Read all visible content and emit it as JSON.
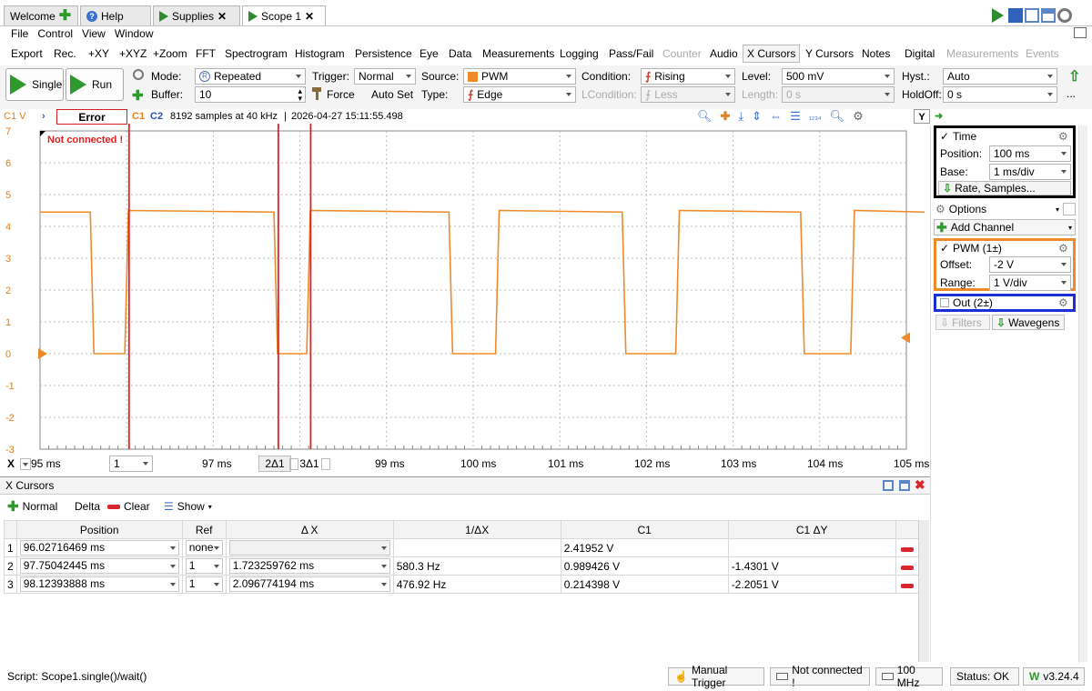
{
  "tabs": [
    {
      "label": "Welcome",
      "icon": "plus-icon"
    },
    {
      "label": "Help",
      "icon": "help-icon"
    },
    {
      "label": "Supplies",
      "icon": "play-icon"
    },
    {
      "label": "Scope 1",
      "icon": "play-icon",
      "active": true
    }
  ],
  "menu": [
    "File",
    "Control",
    "View",
    "Window"
  ],
  "toolbar": {
    "items": [
      "Export",
      "Rec.",
      "+XY",
      "+XYZ",
      "+Zoom",
      "FFT",
      "Spectrogram",
      "Histogram",
      "Persistence",
      "Eye",
      "Data",
      "Measurements",
      "Logging",
      "Pass/Fail",
      "Counter",
      "Audio",
      "X Cursors",
      "Y Cursors",
      "Notes",
      "Digital",
      "Measurements",
      "Events"
    ]
  },
  "controls": {
    "single": "Single",
    "run": "Run",
    "mode_label": "Mode:",
    "mode_value": "Repeated",
    "buffer_label": "Buffer:",
    "buffer_value": "10",
    "trigger_label": "Trigger:",
    "trigger_value": "Normal",
    "force": "Force",
    "autoset": "Auto Set",
    "source_label": "Source:",
    "source_value": "PWM",
    "type_label": "Type:",
    "type_value": "Edge",
    "condition_label": "Condition:",
    "condition_value": "Rising",
    "lcondition_label": "LCondition:",
    "lcondition_value": "Less",
    "level_label": "Level:",
    "level_value": "500 mV",
    "length_label": "Length:",
    "length_value": "0 s",
    "hyst_label": "Hyst.:",
    "hyst_value": "Auto",
    "holdoff_label": "HoldOff:",
    "holdoff_value": "0 s",
    "more": "..."
  },
  "info": {
    "c1v": "C1 V",
    "error": "Error",
    "c1": "C1",
    "c2": "C2",
    "summary": "8192 samples at 40 kHz",
    "timestamp": "2026-04-27 15:11:55.498",
    "y_button": "Y"
  },
  "plot": {
    "not_connected": "Not connected !",
    "y_ticks": [
      "7",
      "6",
      "5",
      "4",
      "3",
      "2",
      "1",
      "0",
      "-1",
      "-2",
      "-3"
    ],
    "color": "#ef8a2a",
    "cursor_color": "#e02020"
  },
  "xaxis": {
    "x_label": "X",
    "first_tick": "95 ms",
    "cursor_select": "1",
    "tick_97": "97 ms",
    "delta_2": "2Δ1",
    "delta_3": "3Δ1",
    "ticks": [
      "99 ms",
      "100 ms",
      "101 ms",
      "102 ms",
      "103 ms",
      "104 ms",
      "105 ms"
    ]
  },
  "xcursors": {
    "title": "X Cursors",
    "normal": "Normal",
    "delta": "Delta",
    "clear": "Clear",
    "show": "Show",
    "headers": [
      "Position",
      "Ref",
      "Δ X",
      "1/ΔX",
      "C1",
      "C1 ΔY"
    ],
    "rows": [
      {
        "idx": "1",
        "position": "96.02716469 ms",
        "ref": "none",
        "dx": "",
        "inv": "",
        "c1": "2.41952 V",
        "c1dy": ""
      },
      {
        "idx": "2",
        "position": "97.75042445 ms",
        "ref": "1",
        "dx": "1.723259762 ms",
        "inv": "580.3 Hz",
        "c1": "0.989426 V",
        "c1dy": "-1.4301 V"
      },
      {
        "idx": "3",
        "position": "98.12393888 ms",
        "ref": "1",
        "dx": "2.096774194 ms",
        "inv": "476.92 Hz",
        "c1": "0.214398 V",
        "c1dy": "-2.2051 V"
      }
    ]
  },
  "right_panel": {
    "time_label": "Time",
    "position_label": "Position:",
    "position_value": "100 ms",
    "base_label": "Base:",
    "base_value": "1 ms/div",
    "rate_btn": "Rate, Samples...",
    "options": "Options",
    "add_channel": "Add Channel",
    "pwm_label": "PWM (1±)",
    "offset_label": "Offset:",
    "offset_value": "-2 V",
    "range_label": "Range:",
    "range_value": "1 V/div",
    "out_label": "Out (2±)",
    "filters": "Filters",
    "wavegens": "Wavegens"
  },
  "status": {
    "script": "Script: Scope1.single()/wait()",
    "manual_trigger": "Manual Trigger",
    "not_connected": "Not connected !",
    "freq": "100 MHz",
    "status": "Status: OK",
    "version": "v3.24.4"
  }
}
